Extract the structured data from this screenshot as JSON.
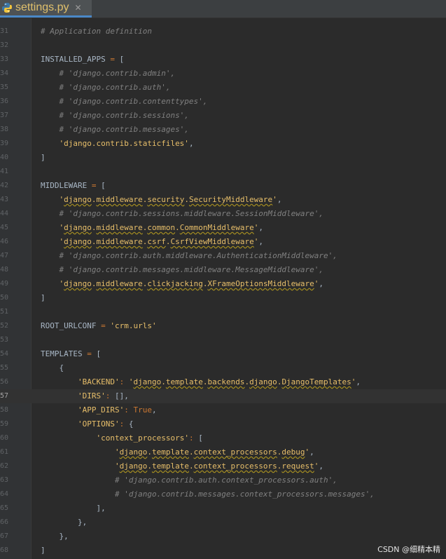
{
  "tab": {
    "filename": "settings.py",
    "close_glyph": "✕"
  },
  "lines": [
    {
      "n": "31",
      "t": "# Application definition",
      "cls": "cmt"
    },
    {
      "n": "32",
      "t": "",
      "cls": ""
    },
    {
      "n": "33",
      "t": "INSTALLED_APPS = [",
      "cls": "assign"
    },
    {
      "n": "34",
      "t": "    # 'django.contrib.admin',",
      "cls": "cmt"
    },
    {
      "n": "35",
      "t": "    # 'django.contrib.auth',",
      "cls": "cmt"
    },
    {
      "n": "36",
      "t": "    # 'django.contrib.contenttypes',",
      "cls": "cmt"
    },
    {
      "n": "37",
      "t": "    # 'django.contrib.sessions',",
      "cls": "cmt"
    },
    {
      "n": "38",
      "t": "    # 'django.contrib.messages',",
      "cls": "cmt"
    },
    {
      "n": "39",
      "t": "    'django.contrib.staticfiles',",
      "cls": "str"
    },
    {
      "n": "40",
      "t": "]",
      "cls": ""
    },
    {
      "n": "41",
      "t": "",
      "cls": ""
    },
    {
      "n": "42",
      "t": "MIDDLEWARE = [",
      "cls": "assign"
    },
    {
      "n": "43",
      "t": "    'django.middleware.security.SecurityMiddleware',",
      "cls": "strsq"
    },
    {
      "n": "44",
      "t": "    # 'django.contrib.sessions.middleware.SessionMiddleware',",
      "cls": "cmt"
    },
    {
      "n": "45",
      "t": "    'django.middleware.common.CommonMiddleware',",
      "cls": "strsq"
    },
    {
      "n": "46",
      "t": "    'django.middleware.csrf.CsrfViewMiddleware',",
      "cls": "strsq"
    },
    {
      "n": "47",
      "t": "    # 'django.contrib.auth.middleware.AuthenticationMiddleware',",
      "cls": "cmt"
    },
    {
      "n": "48",
      "t": "    # 'django.contrib.messages.middleware.MessageMiddleware',",
      "cls": "cmt"
    },
    {
      "n": "49",
      "t": "    'django.middleware.clickjacking.XFrameOptionsMiddleware',",
      "cls": "strsq"
    },
    {
      "n": "50",
      "t": "]",
      "cls": ""
    },
    {
      "n": "51",
      "t": "",
      "cls": ""
    },
    {
      "n": "52",
      "t": "ROOT_URLCONF = 'crm.urls'",
      "cls": "assignstr"
    },
    {
      "n": "53",
      "t": "",
      "cls": ""
    },
    {
      "n": "54",
      "t": "TEMPLATES = [",
      "cls": "assign"
    },
    {
      "n": "55",
      "t": "    {",
      "cls": ""
    },
    {
      "n": "56",
      "t": "        'BACKEND': 'django.template.backends.django.DjangoTemplates',",
      "cls": "kv"
    },
    {
      "n": "57",
      "t": "        'DIRS': [],",
      "cls": "kv"
    },
    {
      "n": "58",
      "t": "        'APP_DIRS': True,",
      "cls": "kv"
    },
    {
      "n": "59",
      "t": "        'OPTIONS': {",
      "cls": "kv"
    },
    {
      "n": "60",
      "t": "            'context_processors': [",
      "cls": "kv"
    },
    {
      "n": "61",
      "t": "                'django.template.context_processors.debug',",
      "cls": "strsq"
    },
    {
      "n": "62",
      "t": "                'django.template.context_processors.request',",
      "cls": "strsq"
    },
    {
      "n": "63",
      "t": "                # 'django.contrib.auth.context_processors.auth',",
      "cls": "cmt"
    },
    {
      "n": "64",
      "t": "                # 'django.contrib.messages.context_processors.messages',",
      "cls": "cmt"
    },
    {
      "n": "65",
      "t": "            ],",
      "cls": ""
    },
    {
      "n": "66",
      "t": "        },",
      "cls": ""
    },
    {
      "n": "67",
      "t": "    },",
      "cls": ""
    },
    {
      "n": "68",
      "t": "]",
      "cls": ""
    }
  ],
  "current_line": "57",
  "watermark": "CSDN @细精本精",
  "colors": {
    "background": "#2b2b2b",
    "keyword": "#cc7832",
    "string": "#e8bf6a",
    "comment": "#808080",
    "text": "#a9b7c6"
  }
}
